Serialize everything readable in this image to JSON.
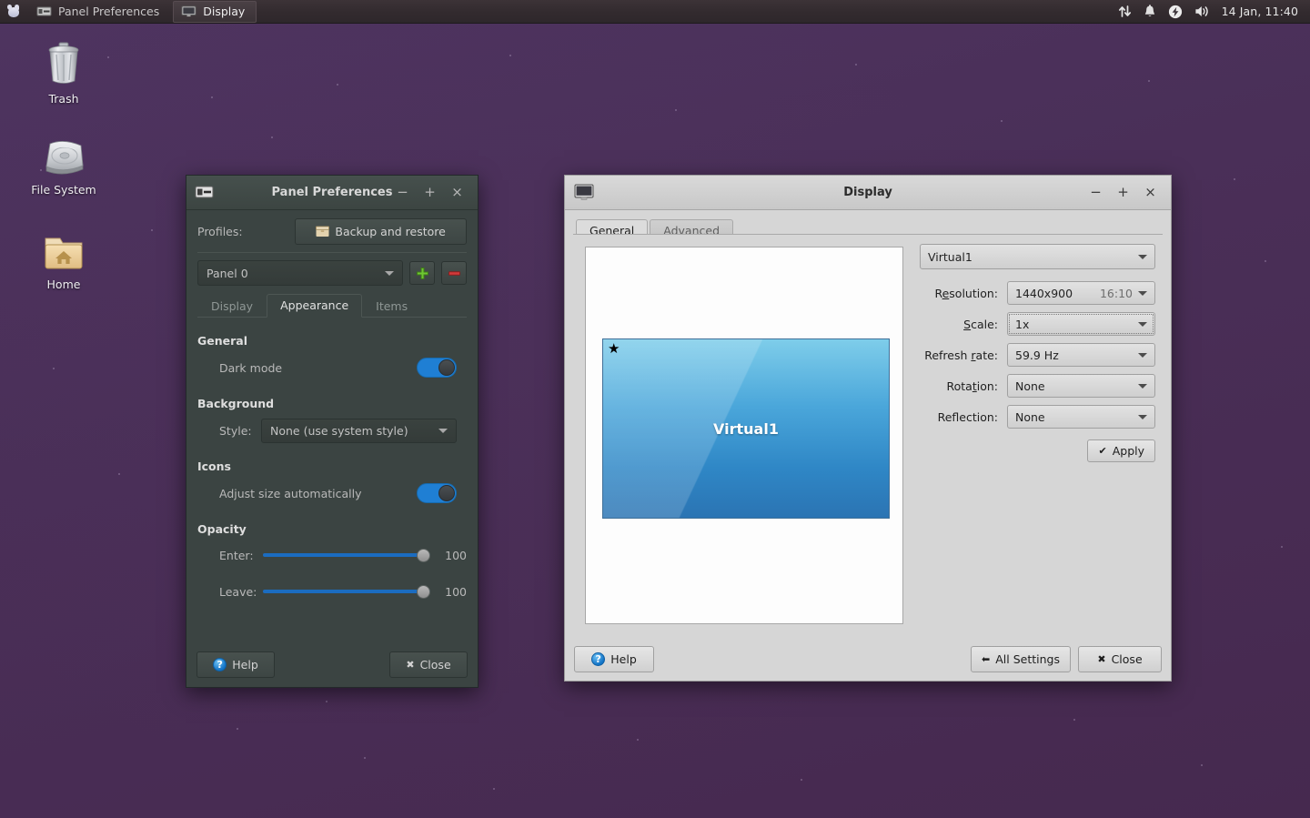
{
  "desktop": {
    "background_color": "#4a2f58",
    "icons": [
      {
        "label": "Trash",
        "icon": "trash-icon"
      },
      {
        "label": "File System",
        "icon": "harddisk-icon"
      },
      {
        "label": "Home",
        "icon": "home-folder-icon"
      }
    ]
  },
  "panel": {
    "menu_icon": "xfce-mouse-logo-icon",
    "tasks": [
      {
        "label": "Panel Preferences",
        "icon": "panel-icon",
        "state": "inactive"
      },
      {
        "label": "Display",
        "icon": "monitor-icon",
        "state": "active"
      }
    ],
    "tray": [
      {
        "icon": "network-updown-icon"
      },
      {
        "icon": "notification-bell-icon"
      },
      {
        "icon": "power-bolt-icon"
      },
      {
        "icon": "volume-speaker-icon"
      }
    ],
    "clock": "14 Jan, 11:40"
  },
  "panel_prefs": {
    "title": "Panel Preferences",
    "window_icon": "panel-icon",
    "titlebar_buttons": {
      "minimize": "−",
      "maximize": "+",
      "close": "×"
    },
    "profiles_label": "Profiles:",
    "backup_button": "Backup and restore",
    "panel_select": {
      "value": "Panel 0"
    },
    "add_button": "+",
    "remove_button": "−",
    "tabs": [
      {
        "label": "Display",
        "active": false
      },
      {
        "label": "Appearance",
        "active": true
      },
      {
        "label": "Items",
        "active": false
      }
    ],
    "sections": {
      "general": {
        "heading": "General",
        "dark_mode_label": "Dark mode",
        "dark_mode_on": true
      },
      "background": {
        "heading": "Background",
        "style_label": "Style:",
        "style_value": "None (use system style)"
      },
      "icons": {
        "heading": "Icons",
        "adjust_label": "Adjust size automatically",
        "adjust_on": true
      },
      "opacity": {
        "heading": "Opacity",
        "enter_label": "Enter:",
        "enter_value": "100",
        "leave_label": "Leave:",
        "leave_value": "100"
      }
    },
    "footer": {
      "help": "Help",
      "close": "Close",
      "close_icon": "✖"
    }
  },
  "display": {
    "title": "Display",
    "window_icon": "monitor-icon",
    "titlebar_buttons": {
      "minimize": "−",
      "maximize": "+",
      "close": "×"
    },
    "tabs": [
      {
        "label": "General",
        "active": true
      },
      {
        "label": "Advanced",
        "active": false
      }
    ],
    "preview": {
      "monitor_name": "Virtual1",
      "primary_marker": "★",
      "primary_marker_name": "primary-display-star-icon"
    },
    "output_select": {
      "value": "Virtual1"
    },
    "fields": [
      {
        "label": "Resolution:",
        "value": "1440x900",
        "aux": "16:10",
        "focused": false
      },
      {
        "label": "Scale:",
        "value": "1x",
        "aux": "",
        "focused": true
      },
      {
        "label": "Refresh rate:",
        "value": "59.9 Hz",
        "aux": "",
        "focused": false
      },
      {
        "label": "Rotation:",
        "value": "None",
        "aux": "",
        "focused": false
      },
      {
        "label": "Reflection:",
        "value": "None",
        "aux": "",
        "focused": false
      }
    ],
    "apply_button": {
      "label": "Apply",
      "icon": "✔"
    },
    "footer": {
      "help": "Help",
      "all_settings": "All Settings",
      "all_settings_icon": "⬅",
      "close": "Close",
      "close_icon": "✖"
    }
  }
}
